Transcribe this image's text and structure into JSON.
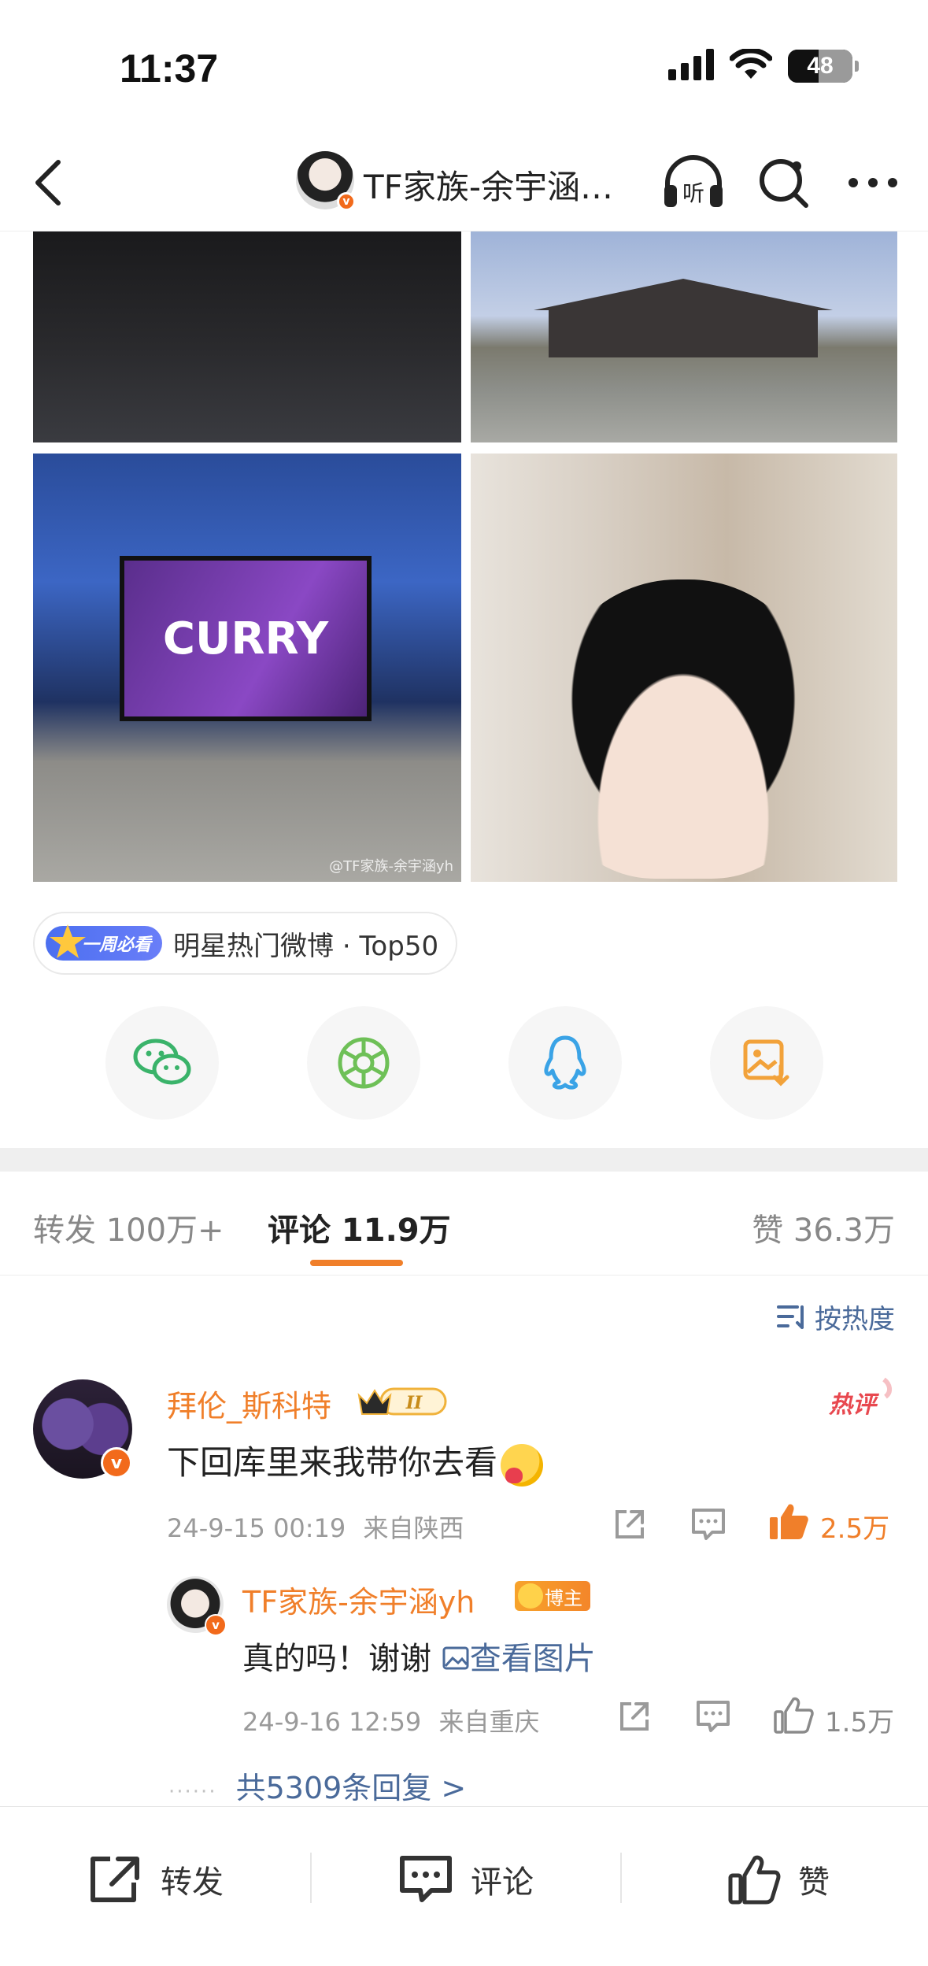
{
  "status_bar": {
    "time": "11:37",
    "battery": "48",
    "battery_level": 0.48
  },
  "nav": {
    "title": "TF家族-余宇涵…"
  },
  "photos": {
    "watermark": "@TF家族-余宇涵yh"
  },
  "tag": {
    "badge": "一周必看",
    "text": "明星热门微博 · Top50"
  },
  "share": {
    "items": [
      "wechat-icon",
      "moments-icon",
      "qq-icon",
      "save-image-icon"
    ]
  },
  "tabs": {
    "repost": "转发 100万+",
    "comment": "评论 11.9万",
    "like": "赞 36.3万"
  },
  "sort": {
    "label": "按热度"
  },
  "comment": {
    "name": "拜伦_斯科特",
    "level": "II",
    "hot_label": "热评",
    "text": "下回库里来我带你去看",
    "date": "24-9-15 00:19",
    "location": "来自陕西",
    "likes": "2.5万",
    "like_color": "#f07f2a"
  },
  "reply": {
    "name": "TF家族-余宇涵yh",
    "badge": "博主",
    "text": "真的吗！谢谢",
    "link": "查看图片",
    "date": "24-9-16 12:59",
    "location": "来自重庆",
    "likes": "1.5万"
  },
  "more_replies": "共5309条回复 >",
  "bottom_bar": {
    "repost": "转发",
    "comment": "评论",
    "like": "赞"
  },
  "colors": {
    "accent": "#f07f2a",
    "link": "#4a6a9a",
    "badge_orange": "#f26a1b"
  }
}
